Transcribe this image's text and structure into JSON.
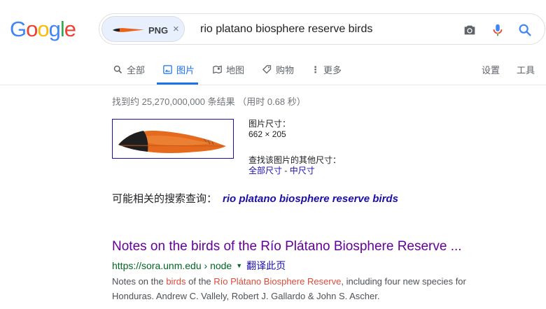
{
  "logo": {
    "letters": [
      "G",
      "o",
      "o",
      "g",
      "l",
      "e"
    ],
    "colors": [
      "#4285f4",
      "#ea4335",
      "#fbbc05",
      "#4285f4",
      "#34a853",
      "#ea4335"
    ]
  },
  "search": {
    "chip_label": "PNG",
    "chip_close": "×",
    "query": "rio platano biosphere reserve birds",
    "icons": [
      "camera-icon",
      "microphone-icon",
      "search-icon"
    ]
  },
  "tabs": {
    "all": "全部",
    "images": "图片",
    "maps": "地图",
    "shopping": "购物",
    "more": "更多",
    "settings": "设置",
    "tools": "工具",
    "active": "images",
    "accent": "#1a73e8"
  },
  "stats": "找到约 25,270,000,000 条结果 （用时 0.68 秒）",
  "image_info": {
    "size_label": "图片尺寸：",
    "size_value": "662 × 205",
    "other_sizes_label": "查找该图片的其他尺寸：",
    "all_sizes": "全部尺寸",
    "separator": " - ",
    "medium_sizes": "中尺寸"
  },
  "related": {
    "label": "可能相关的搜索查询：",
    "query": "rio platano biosphere reserve birds"
  },
  "result": {
    "title": "Notes on the birds of the Río Plátano Biosphere Reserve ...",
    "url": "https://sora.unm.edu › node",
    "dropdown": "▼",
    "translate": "翻译此页",
    "snippet_parts": {
      "p1": "Notes on the ",
      "h1": "birds",
      "p2": " of the ",
      "h2": "Río Plátano Biosphere Reserve",
      "p3": ", including four new species for",
      "line2": "Honduras. Andrew C. Vallely, Robert J. Gallardo & John S. Ascher."
    }
  }
}
